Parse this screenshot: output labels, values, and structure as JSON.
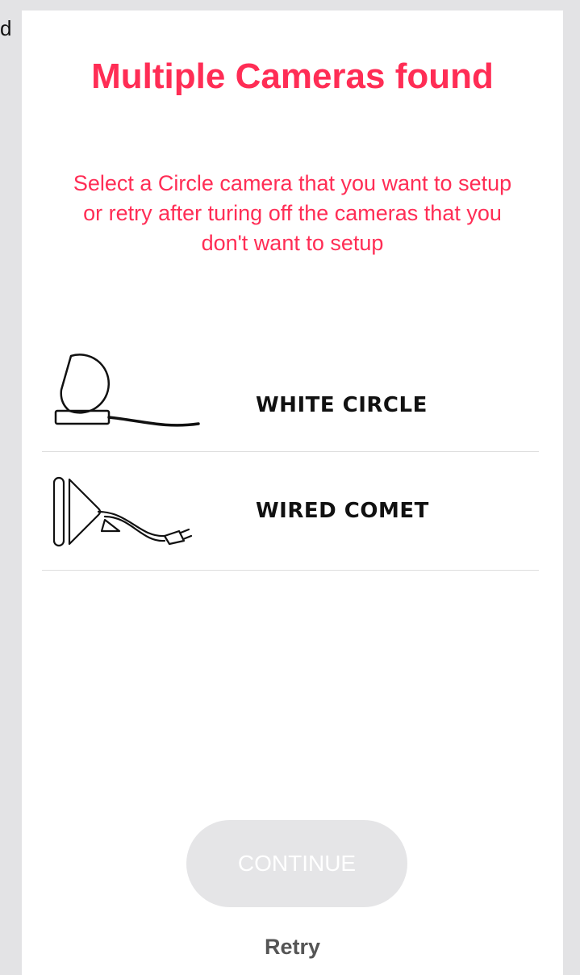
{
  "background_fragment": "d",
  "header": {
    "title": "Multiple Cameras found",
    "subtitle": "Select a Circle camera that you want to setup or retry after turing off the cameras that you don't want to setup"
  },
  "cameras": [
    {
      "label": "WHITE CIRCLE",
      "icon": "white-circle-camera-icon"
    },
    {
      "label": "WIRED COMET",
      "icon": "wired-comet-camera-icon"
    }
  ],
  "actions": {
    "continue_label": "CONTINUE",
    "retry_label": "Retry"
  },
  "colors": {
    "accent": "#ff2d55",
    "button_disabled": "#e5e5e7",
    "background": "#e3e3e5"
  }
}
